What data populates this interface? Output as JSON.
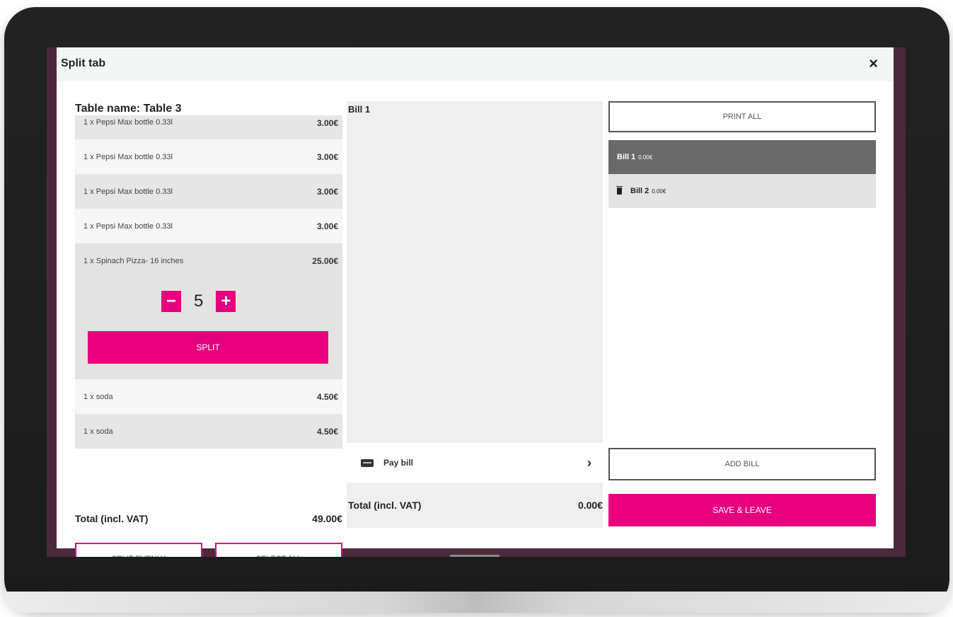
{
  "dialog": {
    "title": "Split tab",
    "close_icon": "×"
  },
  "left": {
    "table_name": "Table name: Table 3",
    "items": [
      {
        "label": "1 x Pepsi Max bottle 0.33l",
        "price": "3.00€"
      },
      {
        "label": "1 x Pepsi Max bottle 0.33l",
        "price": "3.00€"
      },
      {
        "label": "1 x Pepsi Max bottle 0.33l",
        "price": "3.00€"
      },
      {
        "label": "1 x Pepsi Max bottle 0.33l",
        "price": "3.00€"
      },
      {
        "label": "1 x Spinach Pizza- 16 inches",
        "price": "25.00€"
      },
      {
        "label": "1 x soda",
        "price": "4.50€"
      },
      {
        "label": "1 x soda",
        "price": "4.50€"
      }
    ],
    "quantity": {
      "minus": "−",
      "value": "5",
      "plus": "+"
    },
    "split_label": "SPLIT",
    "total_label": "Total (incl. VAT)",
    "total_value": "49.00€",
    "split_evenly_label": "SPLIT EVENLY",
    "select_all_label": "SELECT ALL"
  },
  "middle": {
    "bill_label": "Bill 1",
    "pay_bill_label": "Pay bill",
    "chevron": "›",
    "total_label": "Total (incl. VAT)",
    "total_value": "0.00€"
  },
  "right": {
    "print_all_label": "PRINT ALL",
    "bills": [
      {
        "name": "Bill 1",
        "amount": "0.00€"
      },
      {
        "name": "Bill 2",
        "amount": "0.00€"
      }
    ],
    "add_bill_label": "ADD BILL",
    "save_leave_label": "SAVE & LEAVE"
  },
  "colors": {
    "accent": "#e6007e",
    "active_bill": "#6a6a6a"
  }
}
